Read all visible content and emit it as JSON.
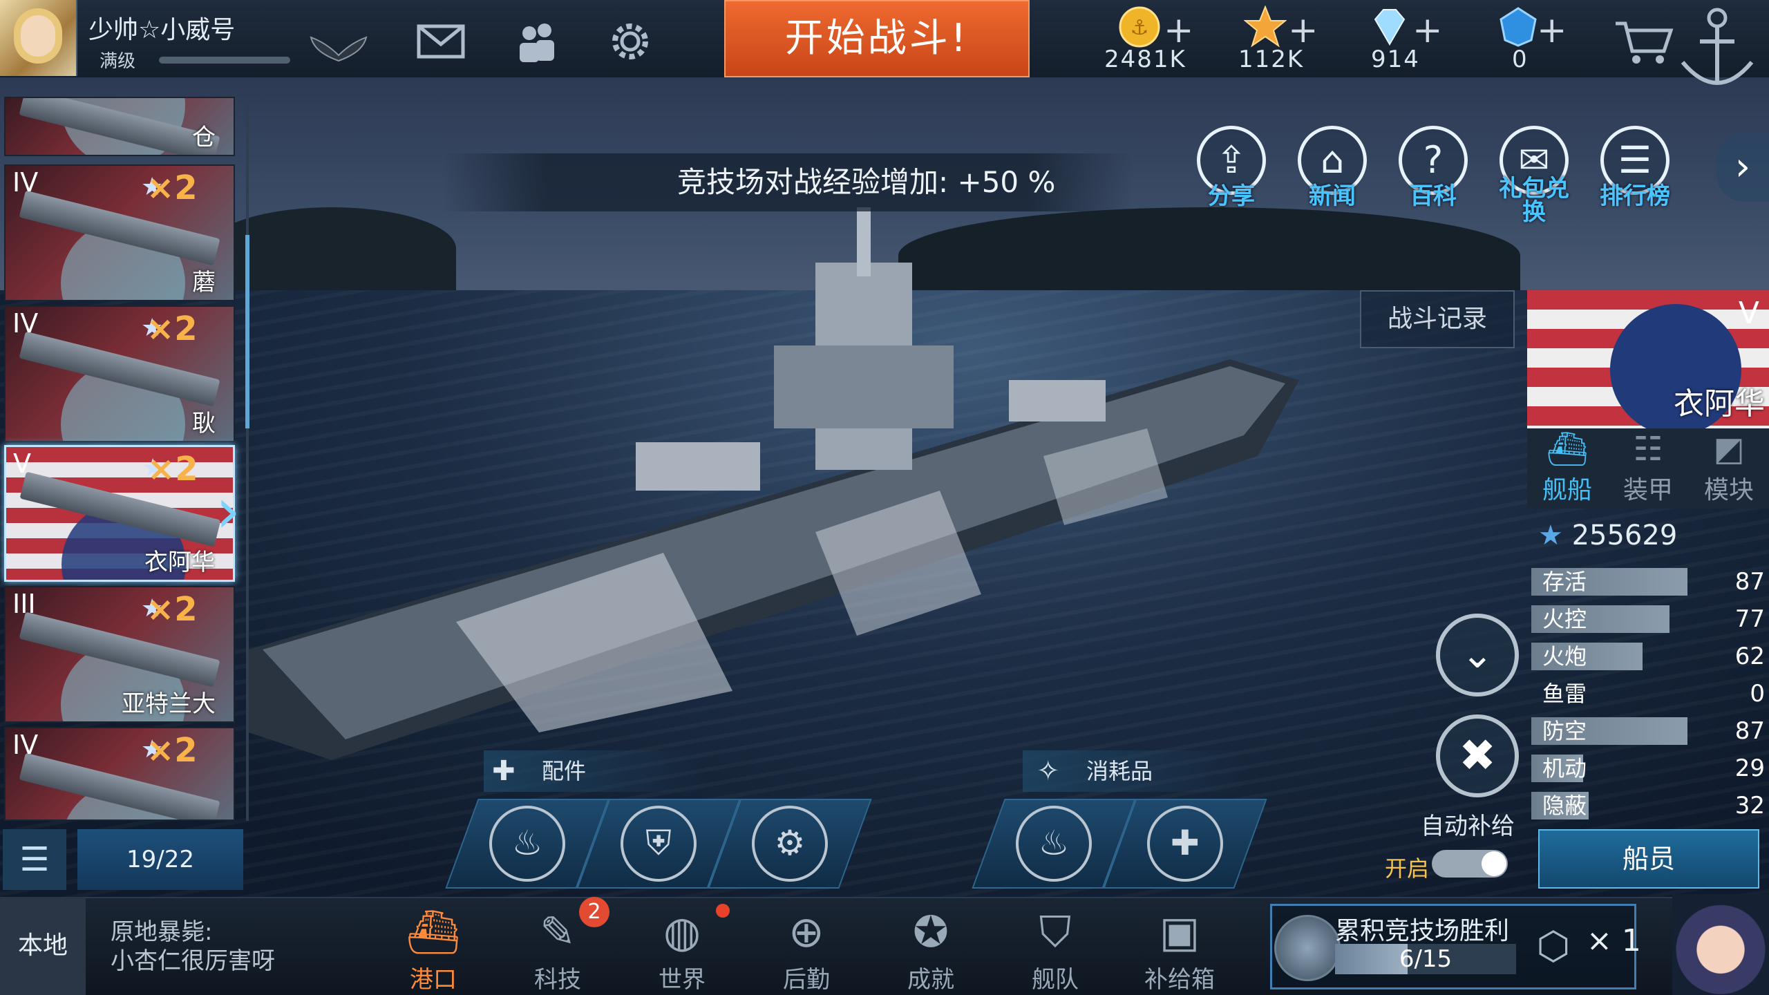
{
  "topbar": {
    "player_name": "少帅☆小威号",
    "player_level": "满级",
    "battle_button": "开始战斗!",
    "icons": {
      "rank": "wings-badge-icon",
      "mail": "mail-icon",
      "friends": "friends-icon",
      "settings": "gear-icon",
      "shop": "cart-icon",
      "anchor": "anchor-icon"
    },
    "resources": [
      {
        "name": "gold-coin-icon",
        "value": "2481K"
      },
      {
        "name": "star-icon",
        "value": "112K"
      },
      {
        "name": "diamond-icon",
        "value": "914"
      },
      {
        "name": "blue-gem-icon",
        "value": "0"
      }
    ],
    "plus_label": "+"
  },
  "exp_banner": "竞技场对战经验增加: +50 %",
  "nav_icons": [
    {
      "label": "分享",
      "icon": "share-icon"
    },
    {
      "label": "新闻",
      "icon": "news-icon"
    },
    {
      "label": "百科",
      "icon": "encyclopedia-icon"
    },
    {
      "label": "礼包兑换",
      "icon": "gift-redeem-icon"
    },
    {
      "label": "排行榜",
      "icon": "leaderboard-icon"
    }
  ],
  "ship_list": [
    {
      "tier": "",
      "mult": "",
      "name": "仓"
    },
    {
      "tier": "IV",
      "mult": "×2",
      "name": "蘑"
    },
    {
      "tier": "IV",
      "mult": "×2",
      "name": "耿"
    },
    {
      "tier": "V",
      "mult": "×2",
      "name": "衣阿华"
    },
    {
      "tier": "III",
      "mult": "×2",
      "name": "亚特兰大"
    },
    {
      "tier": "IV",
      "mult": "×2",
      "name": ""
    }
  ],
  "ship_count": "19/22",
  "battle_record": "战斗记录",
  "selected_ship": {
    "tier": "V",
    "name": "衣阿华",
    "tabs": [
      {
        "label": "舰船",
        "icon": "ship-icon"
      },
      {
        "label": "装甲",
        "icon": "armor-icon"
      },
      {
        "label": "模块",
        "icon": "module-icon"
      }
    ],
    "score": "255629",
    "stats": [
      {
        "label": "存活",
        "value": 87
      },
      {
        "label": "火控",
        "value": 77
      },
      {
        "label": "火炮",
        "value": 62
      },
      {
        "label": "鱼雷",
        "value": 0
      },
      {
        "label": "防空",
        "value": 87
      },
      {
        "label": "机动",
        "value": 29
      },
      {
        "label": "隐蔽",
        "value": 32
      }
    ],
    "crew_button": "船员"
  },
  "auto_supply": {
    "label": "自动补给",
    "state_label": "开启",
    "enabled": true
  },
  "slots": {
    "parts_label": "配件",
    "consumables_label": "消耗品",
    "parts_icons": [
      "extinguisher-icon",
      "repair-shield-icon",
      "gun-turret-icon"
    ],
    "consumable_icons": [
      "extinguisher-icon",
      "repair-plus-icon"
    ]
  },
  "bottom": {
    "local_label": "本地",
    "chat_lines": [
      "原地暴毙:",
      "小杏仁很厉害呀"
    ],
    "nav": [
      {
        "label": "港口",
        "icon": "harbor-icon",
        "badge": ""
      },
      {
        "label": "科技",
        "icon": "tech-icon",
        "badge": "2"
      },
      {
        "label": "世界",
        "icon": "globe-icon",
        "badge": "dot"
      },
      {
        "label": "后勤",
        "icon": "logistics-icon",
        "badge": ""
      },
      {
        "label": "成就",
        "icon": "achievement-icon",
        "badge": ""
      },
      {
        "label": "舰队",
        "icon": "fleet-icon",
        "badge": ""
      },
      {
        "label": "补给箱",
        "icon": "supply-box-icon",
        "badge": ""
      }
    ],
    "arena": {
      "title": "累积竞技场胜利",
      "progress": "6/15",
      "progress_value": 0.4,
      "reward_count": "× 1"
    }
  }
}
